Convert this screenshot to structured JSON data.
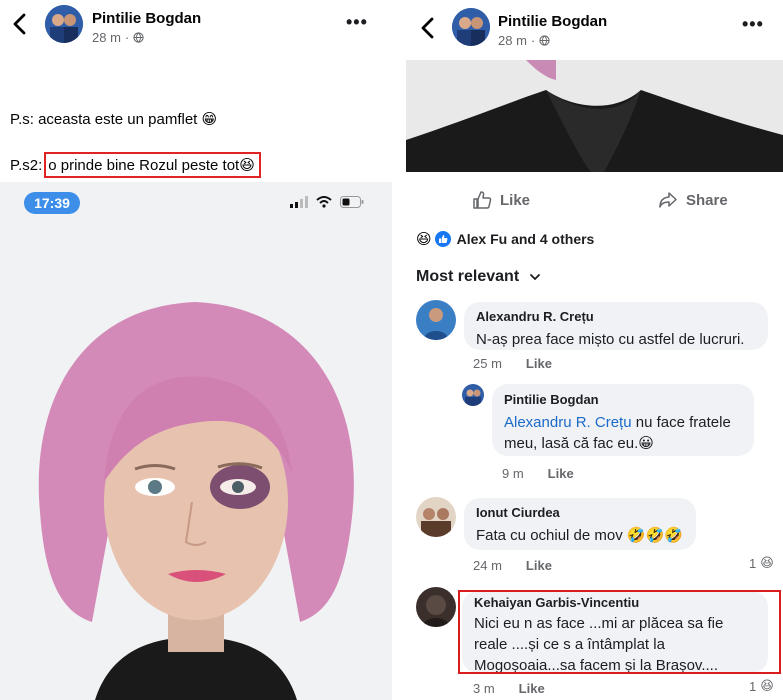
{
  "left": {
    "header": {
      "author": "Pintilie Bogdan",
      "time": "28 m"
    },
    "post_lines": {
      "ps_prefix": "P.s: aceasta este un pamflet ",
      "ps_emoji": "😁",
      "ps2_prefix": "P.s2: ",
      "ps2_highlight": "o prinde bine Rozul peste tot",
      "ps2_emoji": "😆"
    },
    "phone": {
      "time": "17:39"
    }
  },
  "right": {
    "header": {
      "author": "Pintilie Bogdan",
      "time": "28 m"
    },
    "actions": {
      "like": "Like",
      "share": "Share"
    },
    "reactions": {
      "summary": "Alex Fu and 4 others"
    },
    "sort_label": "Most relevant",
    "comments": [
      {
        "author": "Alexandru R. Crețu",
        "text": "N-aș prea face mișto cu astfel de lucruri.",
        "time": "25 m",
        "like": "Like"
      },
      {
        "author": "Pintilie Bogdan",
        "mention": "Alexandru R. Crețu",
        "text_line1": " nu face fratele",
        "text_line2": "meu, lasă că fac eu.",
        "emoji": "😀",
        "time": "9 m",
        "like": "Like"
      },
      {
        "author": "Ionut Ciurdea",
        "text": "Fata cu ochiul de mov ",
        "emoji": "🤣🤣🤣",
        "time": "24 m",
        "like": "Like",
        "reaction_count": "1"
      },
      {
        "author": "Kehaiyan Garbis-Vincentiu",
        "text_line1": "Nici eu n as face ...mi ar plăcea sa fie",
        "text_line2": "reale ....și ce s a întâmplat la",
        "text_line3": "Mogoșoaia...sa facem și la Brașov....",
        "time": "3 m",
        "like": "Like",
        "reaction_count": "1"
      }
    ]
  },
  "icons": {
    "back": "chevron-left-icon",
    "more": "more-horizontal-icon",
    "privacy": "globe-icon",
    "like": "thumbs-up-icon",
    "share": "share-arrow-icon",
    "sort": "chevron-down-icon",
    "reaction_haha": "haha-emoji-icon",
    "reaction_like": "like-reaction-icon"
  },
  "colors": {
    "facebook_blue": "#1877f2",
    "mention_blue": "#1b6ac9",
    "highlight_red": "#d91c1c",
    "secondary_text": "#65676b",
    "bubble_bg": "#f0f2f5"
  }
}
